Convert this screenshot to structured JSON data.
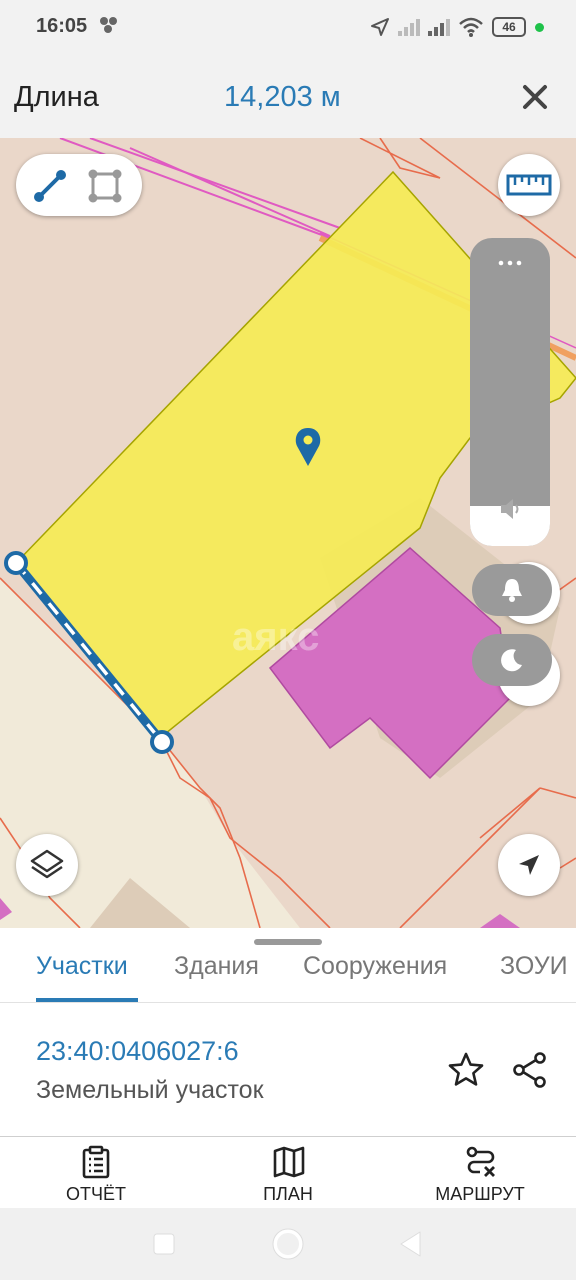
{
  "status_bar": {
    "time": "16:05",
    "battery": "46"
  },
  "header": {
    "label": "Длина",
    "value": "14,203 м"
  },
  "map": {
    "watermark": "аякс",
    "colors": {
      "parcel_fill": "#f5ec55",
      "building_fill": "#d46fc2",
      "measure_line": "#1e6aa6"
    }
  },
  "sheet": {
    "tabs": [
      {
        "label": "Участки",
        "active": true
      },
      {
        "label": "Здания",
        "active": false
      },
      {
        "label": "Сооружения",
        "active": false
      },
      {
        "label": "ЗОУИ",
        "active": false
      }
    ],
    "cadastral_number": "23:40:0406027:6",
    "object_type": "Земельный участок"
  },
  "bottom_nav": {
    "report": "ОТЧЁТ",
    "plan": "ПЛАН",
    "route": "МАРШРУТ"
  },
  "accent_color": "#2a7bb5"
}
